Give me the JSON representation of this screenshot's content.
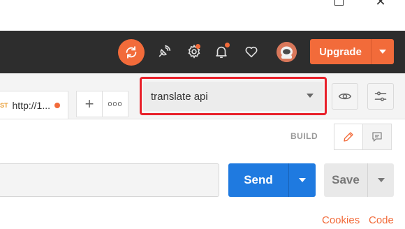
{
  "window": {
    "close_glyph": "✕"
  },
  "header": {
    "upgrade_label": "Upgrade",
    "accent_color": "#f26b3a",
    "background_color": "#2d2d2d"
  },
  "tabs": [
    {
      "method": "ST",
      "url": "http://1...",
      "unsaved": true
    }
  ],
  "tab_controls": {
    "add_glyph": "+",
    "more_glyph": "ooo"
  },
  "environment": {
    "selected": "translate api",
    "highlight_color": "#e8202a"
  },
  "build": {
    "mode_label": "BUILD"
  },
  "request": {
    "url_value": "",
    "send_label": "Send",
    "save_label": "Save",
    "send_color": "#1f7ae0"
  },
  "footer_links": {
    "cookies": "Cookies",
    "code": "Code"
  },
  "icons": [
    "maximize-icon",
    "close-icon",
    "sync-icon",
    "satellite-icon",
    "settings-icon",
    "bell-icon",
    "heart-icon",
    "avatar",
    "chevron-down-icon",
    "eye-icon",
    "sliders-icon",
    "pencil-icon",
    "comment-icon"
  ]
}
